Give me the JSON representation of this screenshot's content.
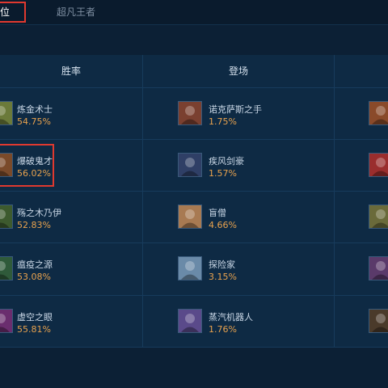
{
  "tabs": [
    {
      "label": "位",
      "active": true
    },
    {
      "label": "超凡王者",
      "active": false
    }
  ],
  "columns": [
    {
      "header": "胜率"
    },
    {
      "header": "登场"
    }
  ],
  "winrate": [
    {
      "name": "炼金术士",
      "value": "54.75%",
      "color": "#6b7a3a"
    },
    {
      "name": "爆破鬼才",
      "value": "56.02%",
      "color": "#7a4a2a"
    },
    {
      "name": "殇之木乃伊",
      "value": "52.83%",
      "color": "#3d5a2e"
    },
    {
      "name": "瘟疫之源",
      "value": "53.08%",
      "color": "#2f5a3a"
    },
    {
      "name": "虚空之眼",
      "value": "55.81%",
      "color": "#6a2d6e"
    }
  ],
  "pickrate": [
    {
      "name": "诺克萨斯之手",
      "value": "1.75%",
      "color": "#7a4030"
    },
    {
      "name": "疾风剑豪",
      "value": "1.57%",
      "color": "#2f3f66"
    },
    {
      "name": "盲僧",
      "value": "4.66%",
      "color": "#a87a52"
    },
    {
      "name": "探险家",
      "value": "3.15%",
      "color": "#6a8aa8"
    },
    {
      "name": "蒸汽机器人",
      "value": "1.76%",
      "color": "#5a4a8a"
    }
  ],
  "third_col_portraits": [
    {
      "color": "#8a4a2a"
    },
    {
      "color": "#9a2d2d"
    },
    {
      "color": "#6a6a3a"
    },
    {
      "color": "#5a3a6a"
    },
    {
      "color": "#4a3a2a"
    }
  ]
}
